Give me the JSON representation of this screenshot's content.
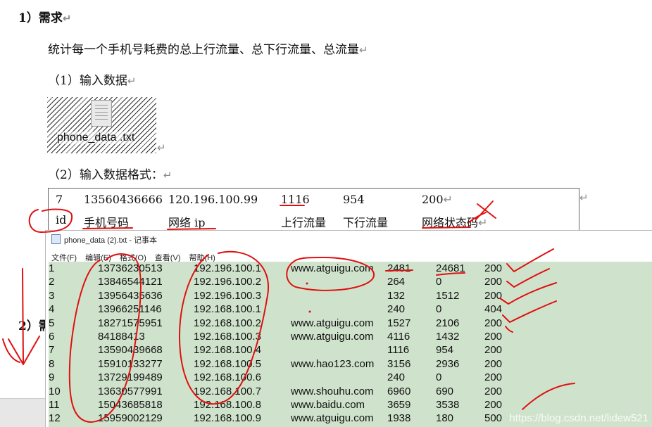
{
  "heading": "1）需求",
  "description": "统计每一个手机号耗费的总上行流量、总下行流量、总流量",
  "input_label": "（1）输入数据",
  "file_name": "phone_data .txt",
  "format_label": "（2）输入数据格式：",
  "format_example": [
    "7",
    "13560436666",
    "120.196.100.99",
    "1116",
    "954",
    "200"
  ],
  "format_fields": [
    "id",
    "手机号码",
    "网络 ip",
    "上行流量",
    "下行流量",
    "网络状态码"
  ],
  "section2": "2）需",
  "notepad": {
    "title": "phone_data (2).txt - 记事本",
    "menu": [
      "文件(F)",
      "编辑(E)",
      "格式(O)",
      "查看(V)",
      "帮助(H)"
    ],
    "rows": [
      [
        "1",
        "13736230513",
        "192.196.100.1",
        "www.atguigu.com",
        "2481",
        "24681",
        "200"
      ],
      [
        "2",
        "13846544121",
        "192.196.100.2",
        "",
        "264",
        "0",
        "200"
      ],
      [
        "3",
        "13956435636",
        "192.196.100.3",
        "",
        "132",
        "1512",
        "200"
      ],
      [
        "4",
        "13966251146",
        "192.168.100.1",
        "",
        "240",
        "0",
        "404"
      ],
      [
        "5",
        "18271575951",
        "192.168.100.2",
        "www.atguigu.com",
        "1527",
        "2106",
        "200"
      ],
      [
        "6",
        "84188413",
        "192.168.100.3",
        "www.atguigu.com",
        "4116",
        "1432",
        "200"
      ],
      [
        "7",
        "13590439668",
        "192.168.100.4",
        "",
        "1116",
        "954",
        "200"
      ],
      [
        "8",
        "15910133277",
        "192.168.100.5",
        "www.hao123.com",
        "3156",
        "2936",
        "200"
      ],
      [
        "9",
        "13729199489",
        "192.168.100.6",
        "",
        "240",
        "0",
        "200"
      ],
      [
        "10",
        "13630577991",
        "192.168.100.7",
        "www.shouhu.com",
        "6960",
        "690",
        "200"
      ],
      [
        "11",
        "15043685818",
        "192.168.100.8",
        "www.baidu.com",
        "3659",
        "3538",
        "200"
      ],
      [
        "12",
        "15959002129",
        "192.168.100.9",
        "www.atguigu.com",
        "1938",
        "180",
        "500"
      ]
    ]
  },
  "watermark": "https://blog.csdn.net/lidew521",
  "paragraph_mark": "↵"
}
